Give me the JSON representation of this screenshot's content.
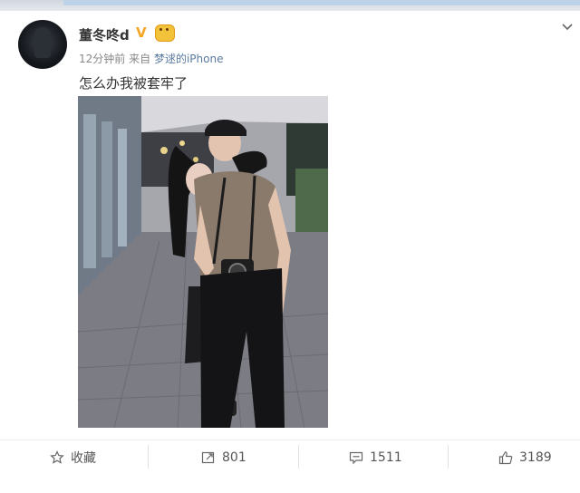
{
  "post": {
    "username": "董冬咚d",
    "verified_badge": "V",
    "time": "12分钟前",
    "source_prefix": "来自",
    "source": "梦逑的iPhone",
    "text": "怎么办我被套牢了",
    "menu_icon": "chevron-down-icon"
  },
  "actions": {
    "favorite_label": "收藏",
    "repost_count": "801",
    "comment_count": "1511",
    "like_count": "3189"
  },
  "icons": {
    "favorite": "star-icon",
    "repost": "repost-icon",
    "comment": "comment-icon",
    "like": "thumbs-up-icon"
  },
  "colors": {
    "verified": "#f5a623",
    "source_link": "#5a7aa0",
    "text": "#333333",
    "meta": "#888888"
  }
}
